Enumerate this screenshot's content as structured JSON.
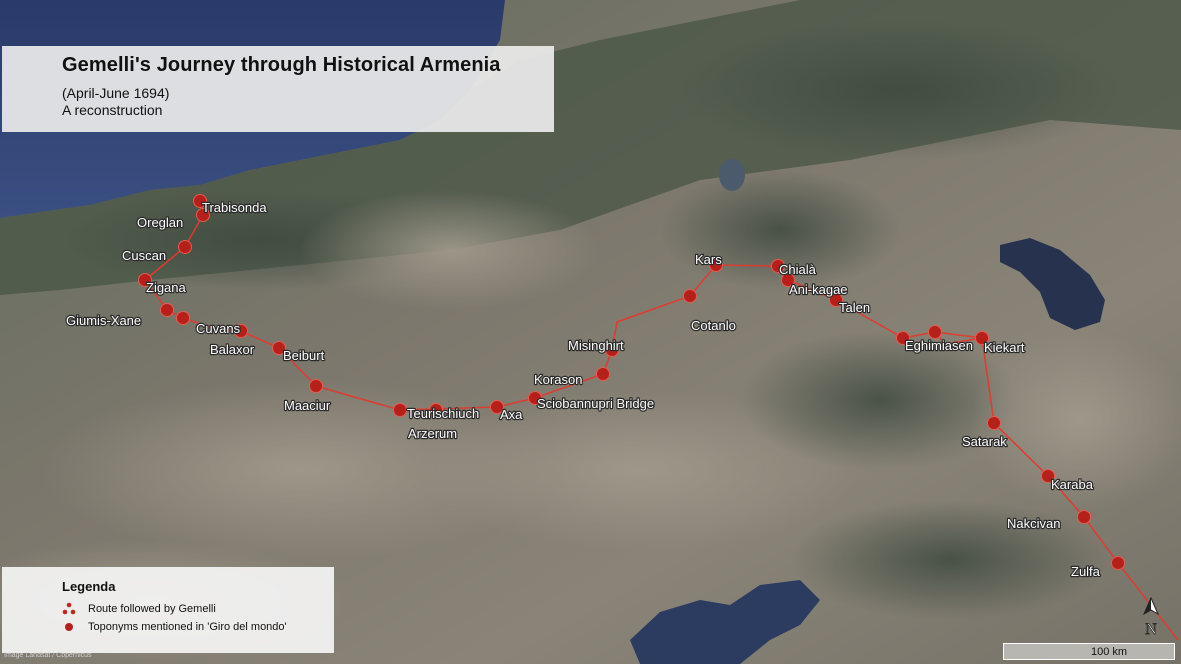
{
  "map": {
    "title": "Gemelli's Journey through Historical Armenia",
    "subtitle_dates": "(April-June 1694)",
    "subtitle_note": "A reconstruction",
    "route_color": "#e03a2e",
    "marker_color": "#b5201a",
    "places": [
      "Trabisonda",
      "Oreglan",
      "Cuscan",
      "Zigana",
      "Giumis-Xane",
      "Cuvans",
      "Balaxor",
      "Beiburt",
      "Maaciur",
      "Teurischiuch",
      "Arzerum",
      "Axa",
      "Sciobannupri Bridge",
      "Korason",
      "Misinghirt",
      "Cotanlo",
      "Kars",
      "Chialà",
      "Ani-kagae",
      "Talen",
      "Eghimiasen",
      "Kiekart",
      "Satarak",
      "Karaba",
      "Nakcivan",
      "Zulfa"
    ]
  },
  "legend": {
    "title": "Legenda",
    "route_label": "Route followed by Gemelli",
    "toponym_label": "Toponyms mentioned in 'Giro del mondo'"
  },
  "scale": {
    "label": "100 km"
  },
  "north_arrow": {
    "label": "N"
  },
  "credit": "Image Landsat / Copernicus"
}
